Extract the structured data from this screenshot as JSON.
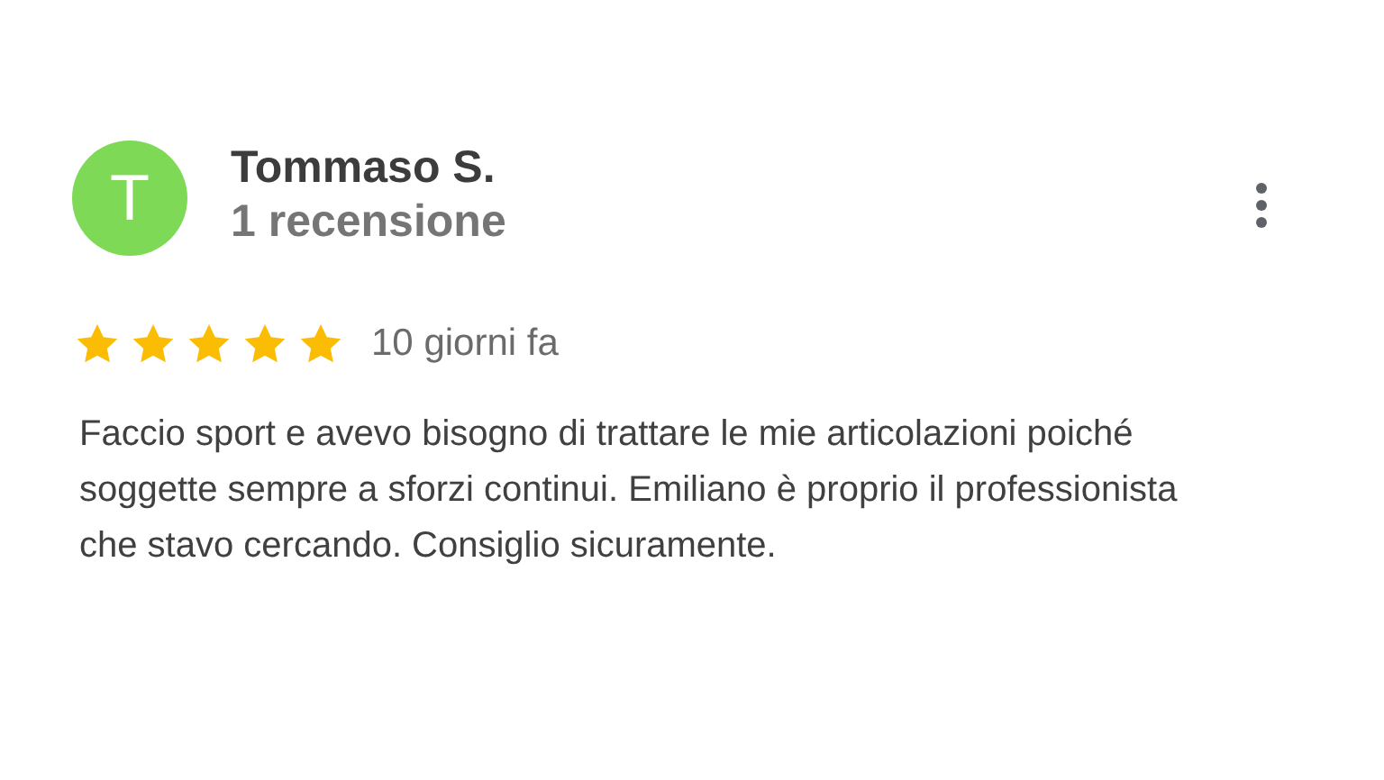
{
  "reviewer": {
    "initial": "T",
    "name": "Tommaso S.",
    "reviews": "1 recensione"
  },
  "rating": {
    "stars": 5,
    "date": "10 giorni fa"
  },
  "text": "Faccio sport e avevo bisogno di trattare le mie articolazioni poiché soggette sempre a sforzi continui. Emiliano è proprio il professionista che stavo cercando. Consiglio sicuramente."
}
